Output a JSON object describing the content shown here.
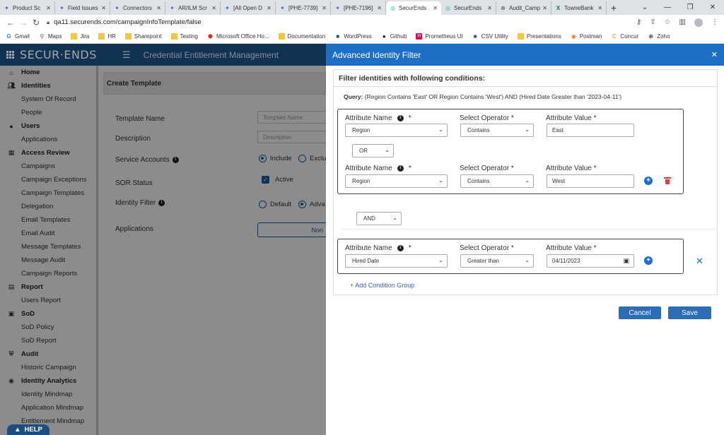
{
  "browser": {
    "tabs": [
      {
        "label": "Product Sc",
        "icon": "jira-icon"
      },
      {
        "label": "Field Issues",
        "icon": "jira-icon"
      },
      {
        "label": "Connectors",
        "icon": "jira-icon"
      },
      {
        "label": "AR/ILM Scr",
        "icon": "jira-icon"
      },
      {
        "label": "[All Open D",
        "icon": "jira-icon"
      },
      {
        "label": "[PHE-7739]",
        "icon": "jira-icon"
      },
      {
        "label": "[PHE-7196]",
        "icon": "jira-icon"
      },
      {
        "label": "SecurEnds",
        "icon": "securends-icon"
      },
      {
        "label": "SecurEnds",
        "icon": "securends-icon"
      },
      {
        "label": "Audit_Camp",
        "icon": "globe-icon"
      },
      {
        "label": "TowneBank",
        "icon": "excel-icon"
      }
    ],
    "active_tab_index": 7,
    "url": "qa11.securends.com/campaignInfoTemplate/false",
    "bookmarks": [
      "Gmail",
      "Maps",
      "Jira",
      "HR",
      "Sharepoint",
      "Testing",
      "Microsoft Office Ho...",
      "Documentation",
      "WordPress",
      "Github",
      "Prometheus UI",
      "CSV Utility",
      "Presentations",
      "Postman",
      "Concur",
      "Zoho"
    ]
  },
  "app": {
    "logo": "SECUR·ENDS",
    "title": "Credential Entitlement Management"
  },
  "sidebar": {
    "items": [
      {
        "label": "Home",
        "type": "head",
        "icon": "home-icon"
      },
      {
        "label": "Identities",
        "type": "head",
        "icon": "users-icon"
      },
      {
        "label": "System Of Record",
        "type": "sub"
      },
      {
        "label": "People",
        "type": "sub"
      },
      {
        "label": "Users",
        "type": "head",
        "icon": "user-icon"
      },
      {
        "label": "Applications",
        "type": "sub"
      },
      {
        "label": "Access Review",
        "type": "head",
        "icon": "grid-icon"
      },
      {
        "label": "Campaigns",
        "type": "sub"
      },
      {
        "label": "Campaign Exceptions",
        "type": "sub"
      },
      {
        "label": "Campaign Templates",
        "type": "sub"
      },
      {
        "label": "Delegation",
        "type": "sub"
      },
      {
        "label": "Email Templates",
        "type": "sub"
      },
      {
        "label": "Email Audit",
        "type": "sub"
      },
      {
        "label": "Message Templates",
        "type": "sub"
      },
      {
        "label": "Message Audit",
        "type": "sub"
      },
      {
        "label": "Campaign Reports",
        "type": "sub"
      },
      {
        "label": "Report",
        "type": "head",
        "icon": "report-icon"
      },
      {
        "label": "Users Report",
        "type": "sub"
      },
      {
        "label": "SoD",
        "type": "head",
        "icon": "sod-icon"
      },
      {
        "label": "SoD Policy",
        "type": "sub"
      },
      {
        "label": "SoD Report",
        "type": "sub"
      },
      {
        "label": "Audit",
        "type": "head",
        "icon": "shield-icon"
      },
      {
        "label": "Historic Campaign",
        "type": "sub"
      },
      {
        "label": "Identity Analytics",
        "type": "head",
        "icon": "analytics-icon"
      },
      {
        "label": "Identity Mindmap",
        "type": "sub"
      },
      {
        "label": "Application Mindmap",
        "type": "sub"
      },
      {
        "label": "Entitlement Mindmap",
        "type": "sub"
      }
    ],
    "help_label": "HELP"
  },
  "form": {
    "header": "Create Template",
    "template_name_label": "Template Name",
    "template_name_placeholder": "Template Name",
    "description_label": "Description",
    "description_placeholder": "Description",
    "service_accounts_label": "Service Accounts",
    "service_include": "Include",
    "service_exclude": "Exclu",
    "sor_status_label": "SOR Status",
    "sor_active": "Active",
    "identity_filter_label": "Identity Filter",
    "identity_default": "Default",
    "identity_advanced": "Adva",
    "applications_label": "Applications",
    "applications_button": "Non"
  },
  "filter": {
    "title": "Advanced Identity Filter",
    "card_title": "Filter identities with following conditions:",
    "query_label": "Query:",
    "query_text": "(Region Contains 'East' OR Region Contains 'West') AND (Hired Date Greater than '2023-04-11')",
    "col_attribute_name": "Attribute Name",
    "col_operator": "Select Operator",
    "col_value": "Attribute Value",
    "required_mark": "*",
    "group1": {
      "rows": [
        {
          "attribute": "Region",
          "operator": "Contains",
          "value": "East"
        },
        {
          "attribute": "Region",
          "operator": "Contains",
          "value": "West"
        }
      ],
      "inner_logic": "OR"
    },
    "group_logic": "AND",
    "group2": {
      "rows": [
        {
          "attribute": "Hired Date",
          "operator": "Greater than",
          "value": "04/11/2023"
        }
      ]
    },
    "add_group_label": "+ Add Condition Group",
    "cancel_label": "Cancel",
    "save_label": "Save"
  }
}
